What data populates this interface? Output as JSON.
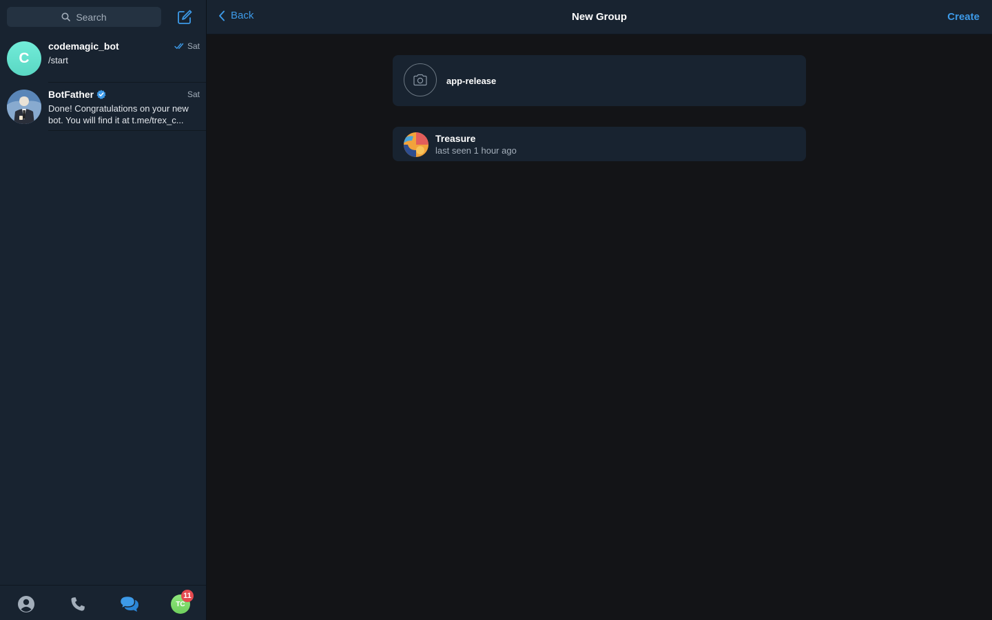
{
  "sidebar": {
    "search": {
      "placeholder": "Search"
    },
    "chats": [
      {
        "name": "codemagic_bot",
        "avatar_letter": "C",
        "time": "Sat",
        "read_status": "double-check-icon",
        "message": "/start"
      },
      {
        "name": "BotFather",
        "verified": true,
        "time": "Sat",
        "message": "Done! Congratulations on your new bot. You will find it at t.me/trex_c..."
      }
    ],
    "tabbar": {
      "items": [
        "contacts-icon",
        "calls-icon",
        "chats-icon",
        "settings-avatar"
      ],
      "active": "chats-icon",
      "profile_initials": "TC",
      "badge": "11"
    }
  },
  "header": {
    "back_label": "Back",
    "title": "New Group",
    "create_label": "Create"
  },
  "group": {
    "name_value": "app-release"
  },
  "members": [
    {
      "name": "Treasure",
      "status": "last seen 1 hour ago"
    }
  ],
  "colors": {
    "accent": "#3d9ae8",
    "sidebar_bg": "#182330",
    "main_bg": "#131417",
    "badge": "#e4494f"
  }
}
